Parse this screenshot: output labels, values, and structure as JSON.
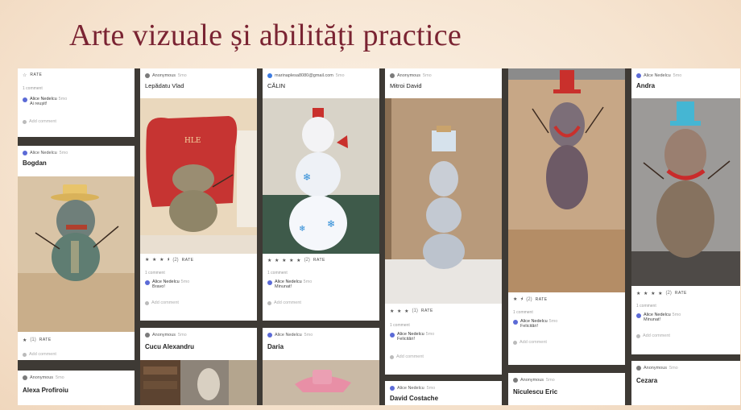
{
  "slide": {
    "title": "Arte vizuale și abilități practice"
  },
  "col1": {
    "top_rate": "RATE",
    "top_comment_count": "1 comment",
    "top_comment_author": "Alice Nedelcu",
    "top_comment_ago": "5mo",
    "top_comment_text": "Ai reușit!",
    "top_add": "Add comment",
    "card2_author": "Alice Nedelcu",
    "card2_ago": "5mo",
    "card2_title": "Bogdan",
    "card2_stars": "★",
    "card2_count": "(1)",
    "card2_rate": "RATE",
    "card2_add": "Add comment",
    "card3_author": "Anonymous",
    "card3_ago": "5mo",
    "card3_title": "Alexa Profiroiu"
  },
  "col2": {
    "author": "Anonymous",
    "ago": "5mo",
    "title": "Lepădatu Vlad",
    "stars": "★ ★ ★ ⯨",
    "count": "(2)",
    "rate": "RATE",
    "comment_count": "1 comment",
    "comment_author": "Alice Nedelcu",
    "comment_ago": "5mo",
    "comment_text": "Bravo!",
    "add": "Add comment",
    "card2_author": "Anonymous",
    "card2_ago": "5mo",
    "card2_title": "Cucu Alexandru"
  },
  "col3": {
    "author": "marinaplesa8080@gmail.com",
    "ago": "5mo",
    "title": "CĂLIN",
    "stars": "★ ★ ★ ★ ★",
    "count": "(2)",
    "rate": "RATE",
    "comment_count": "1 comment",
    "comment_author": "Alice Nedelcu",
    "comment_ago": "5mo",
    "comment_text": "Minunat!",
    "add": "Add comment",
    "card2_author": "Alice Nedelcu",
    "card2_ago": "5mo",
    "card2_title": "Daria"
  },
  "col4": {
    "author": "Anonymous",
    "ago": "5mo",
    "title": "Mitroi David",
    "stars": "★ ★ ★",
    "count": "(1)",
    "rate": "RATE",
    "comment_count": "1 comment",
    "comment_author": "Alice Nedelcu",
    "comment_ago": "5mo",
    "comment_text": "Felicitări!",
    "add": "Add comment",
    "card2_author": "Alice Nedelcu",
    "card2_ago": "5mo",
    "card2_title": "David Costache"
  },
  "col5": {
    "stars": "★ ⯨",
    "count": "(2)",
    "rate": "RATE",
    "comment_count": "1 comment",
    "comment_author": "Alice Nedelcu",
    "comment_ago": "5mo",
    "comment_text": "Felicitări!",
    "add": "Add comment",
    "card2_author": "Anonymous",
    "card2_ago": "5mo",
    "card2_title": "Niculescu Eric"
  },
  "col6": {
    "author": "Alice Nedelcu",
    "ago": "5mo",
    "title": "Andra",
    "stars": "★ ★ ★ ★",
    "count": "(2)",
    "rate": "RATE",
    "comment_count": "1 comment",
    "comment_author": "Alice Nedelcu",
    "comment_ago": "5mo",
    "comment_text": "Minunat!",
    "add": "Add comment",
    "card2_author": "Anonymous",
    "card2_ago": "5mo",
    "card2_title": "Cezara"
  }
}
